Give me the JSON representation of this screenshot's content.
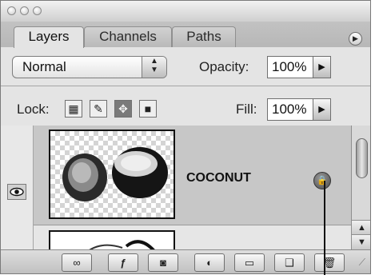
{
  "tabs": [
    {
      "label": "Layers",
      "active": true
    },
    {
      "label": "Channels",
      "active": false
    },
    {
      "label": "Paths",
      "active": false
    }
  ],
  "blend_mode": {
    "value": "Normal"
  },
  "opacity": {
    "label": "Opacity:",
    "value": "100%"
  },
  "lock": {
    "label": "Lock:"
  },
  "fill": {
    "label": "Fill:",
    "value": "100%"
  },
  "layers": [
    {
      "name": "COCONUT",
      "visible": true,
      "selected": true,
      "locked": true
    },
    {
      "name": "",
      "visible": false,
      "selected": false
    }
  ],
  "colors": {
    "panel_bg": "#d7d7d7",
    "selected_row": "#c7c7c7"
  },
  "bottom_icons": [
    "link-icon",
    "layer-style-icon",
    "layer-mask-icon",
    "adjustment-layer-icon",
    "group-folder-icon",
    "new-layer-icon",
    "trash-icon"
  ]
}
